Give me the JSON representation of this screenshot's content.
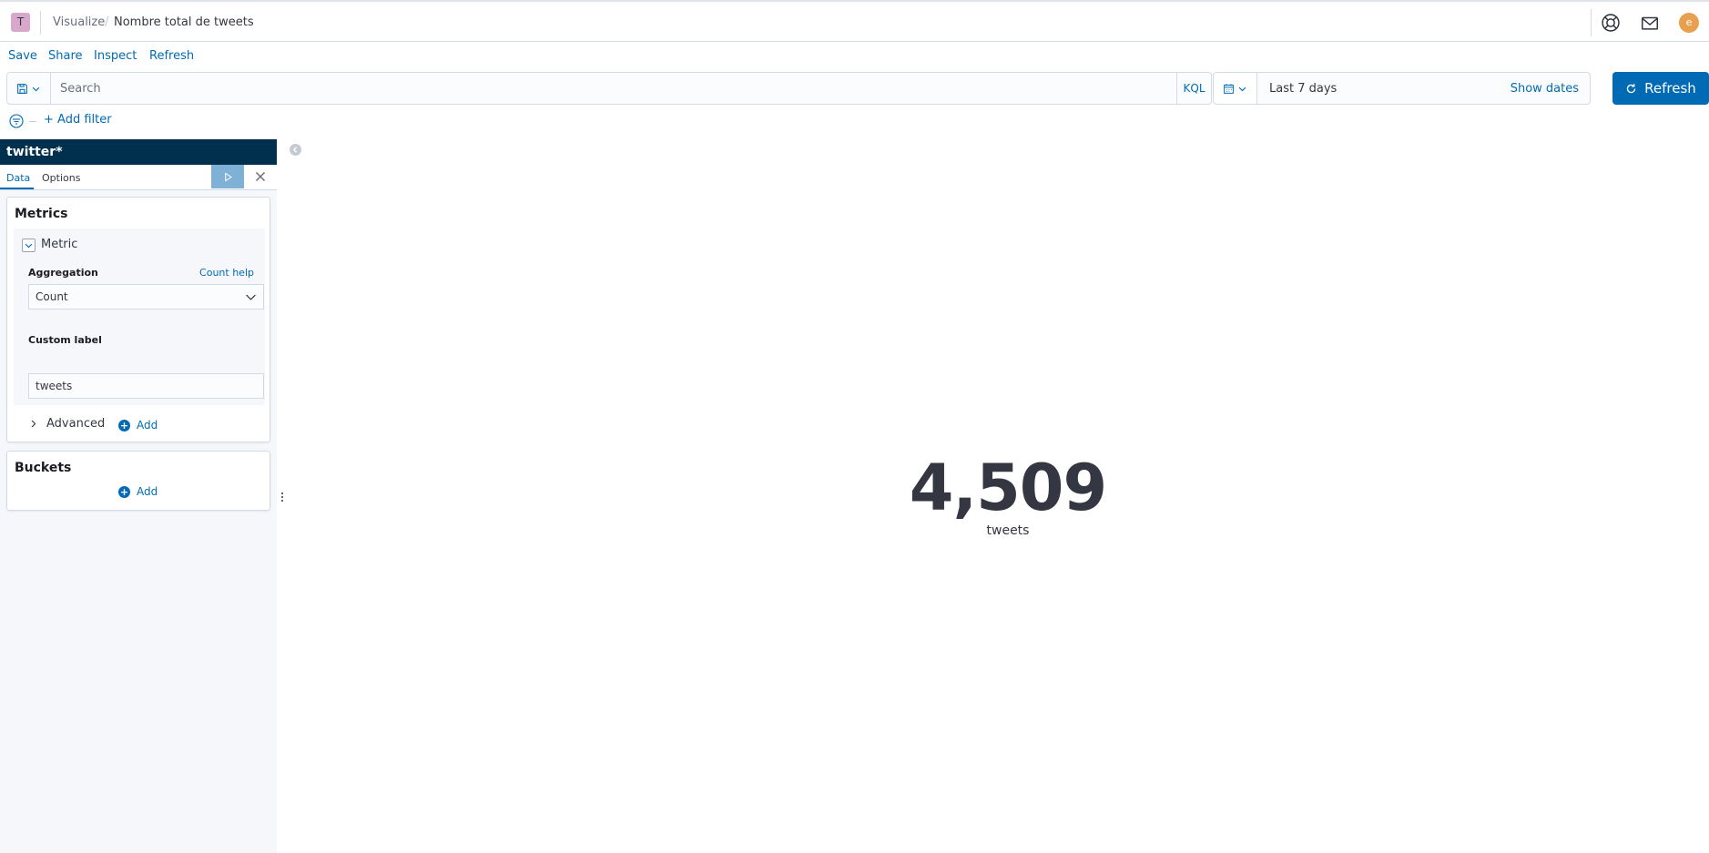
{
  "header": {
    "app_initial": "T",
    "breadcrumbs": [
      "Visualize",
      "Nombre total de tweets"
    ],
    "separator": "/",
    "user_initial": "e"
  },
  "top_nav": {
    "save": "Save",
    "share": "Share",
    "inspect": "Inspect",
    "refresh": "Refresh"
  },
  "query_bar": {
    "search_placeholder": "Search",
    "search_value": "",
    "language": "KQL",
    "date_range": "Last 7 days",
    "show_dates": "Show dates",
    "refresh_label": "Refresh"
  },
  "filter_bar": {
    "add_filter": "+ Add filter"
  },
  "sidebar": {
    "index_pattern": "twitter*",
    "tabs": [
      "Data",
      "Options"
    ],
    "active_tab": "Data",
    "metrics": {
      "title": "Metrics",
      "metric_title": "Metric",
      "aggregation_label": "Aggregation",
      "help_link": "Count help",
      "aggregation_value": "Count",
      "custom_label_label": "Custom label",
      "custom_label_value": "tweets",
      "advanced": "Advanced",
      "add": "Add"
    },
    "buckets": {
      "title": "Buckets",
      "add": "Add"
    }
  },
  "visualization": {
    "value": "4,509",
    "label": "tweets"
  },
  "colors": {
    "accent": "#006bb4",
    "index_header": "#00304d",
    "text": "#343741"
  },
  "icons": {
    "help": "help-icon",
    "mail": "mail-icon",
    "saved_query": "save-icon",
    "calendar": "calendar-icon",
    "refresh": "refresh-icon",
    "filter": "filter-icon",
    "apply": "play-icon",
    "close": "close-icon"
  }
}
